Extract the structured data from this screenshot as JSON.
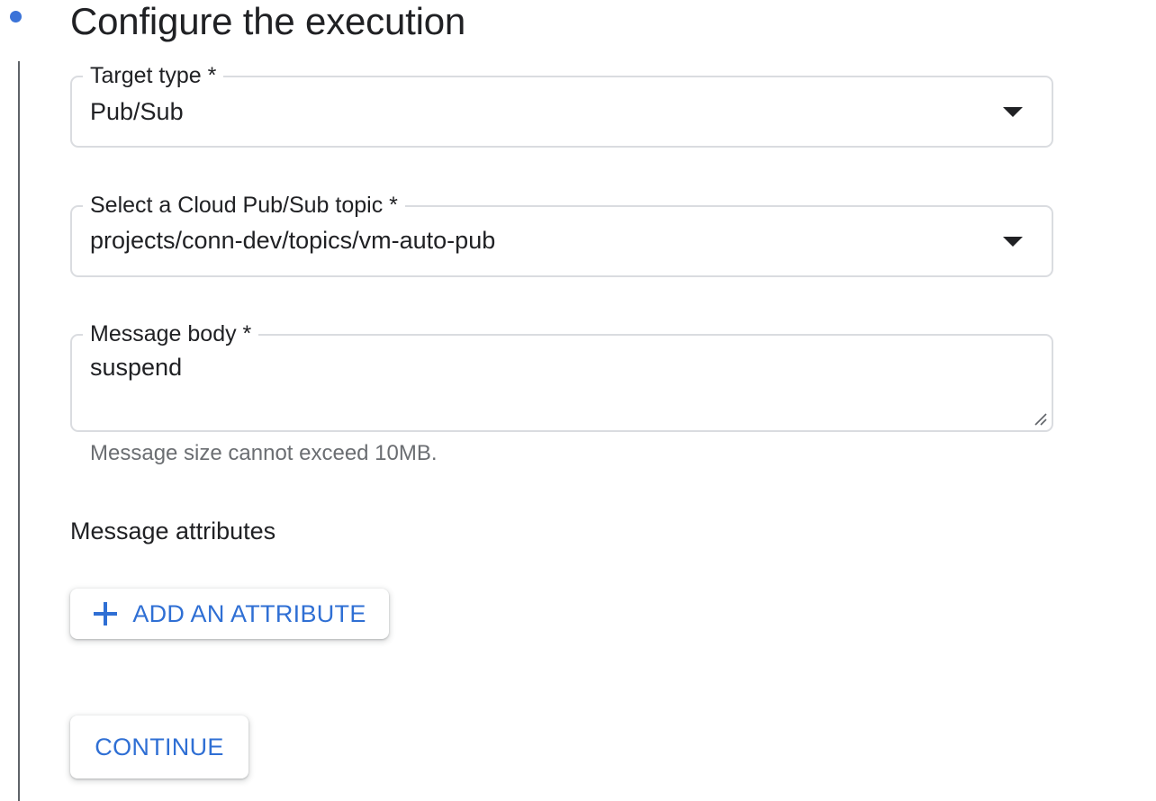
{
  "step": {
    "title": "Configure the execution"
  },
  "target_type": {
    "label": "Target type *",
    "value": "Pub/Sub"
  },
  "pubsub_topic": {
    "label": "Select a Cloud Pub/Sub topic *",
    "value": "projects/conn-dev/topics/vm-auto-pub"
  },
  "message_body": {
    "label": "Message body *",
    "value": "suspend",
    "helper": "Message size cannot exceed 10MB."
  },
  "message_attributes": {
    "heading": "Message attributes",
    "add_button_label": "ADD AN ATTRIBUTE"
  },
  "continue_button_label": "CONTINUE",
  "icons": {
    "step_indicator": "step-dot-icon",
    "dropdown": "caret-down-icon",
    "resize": "resize-grip-icon",
    "add": "plus-icon"
  },
  "colors": {
    "accent": "#3b73d8",
    "button_text": "#2f6fd4",
    "border": "#dadce0",
    "helper_text": "#6b6e72"
  }
}
